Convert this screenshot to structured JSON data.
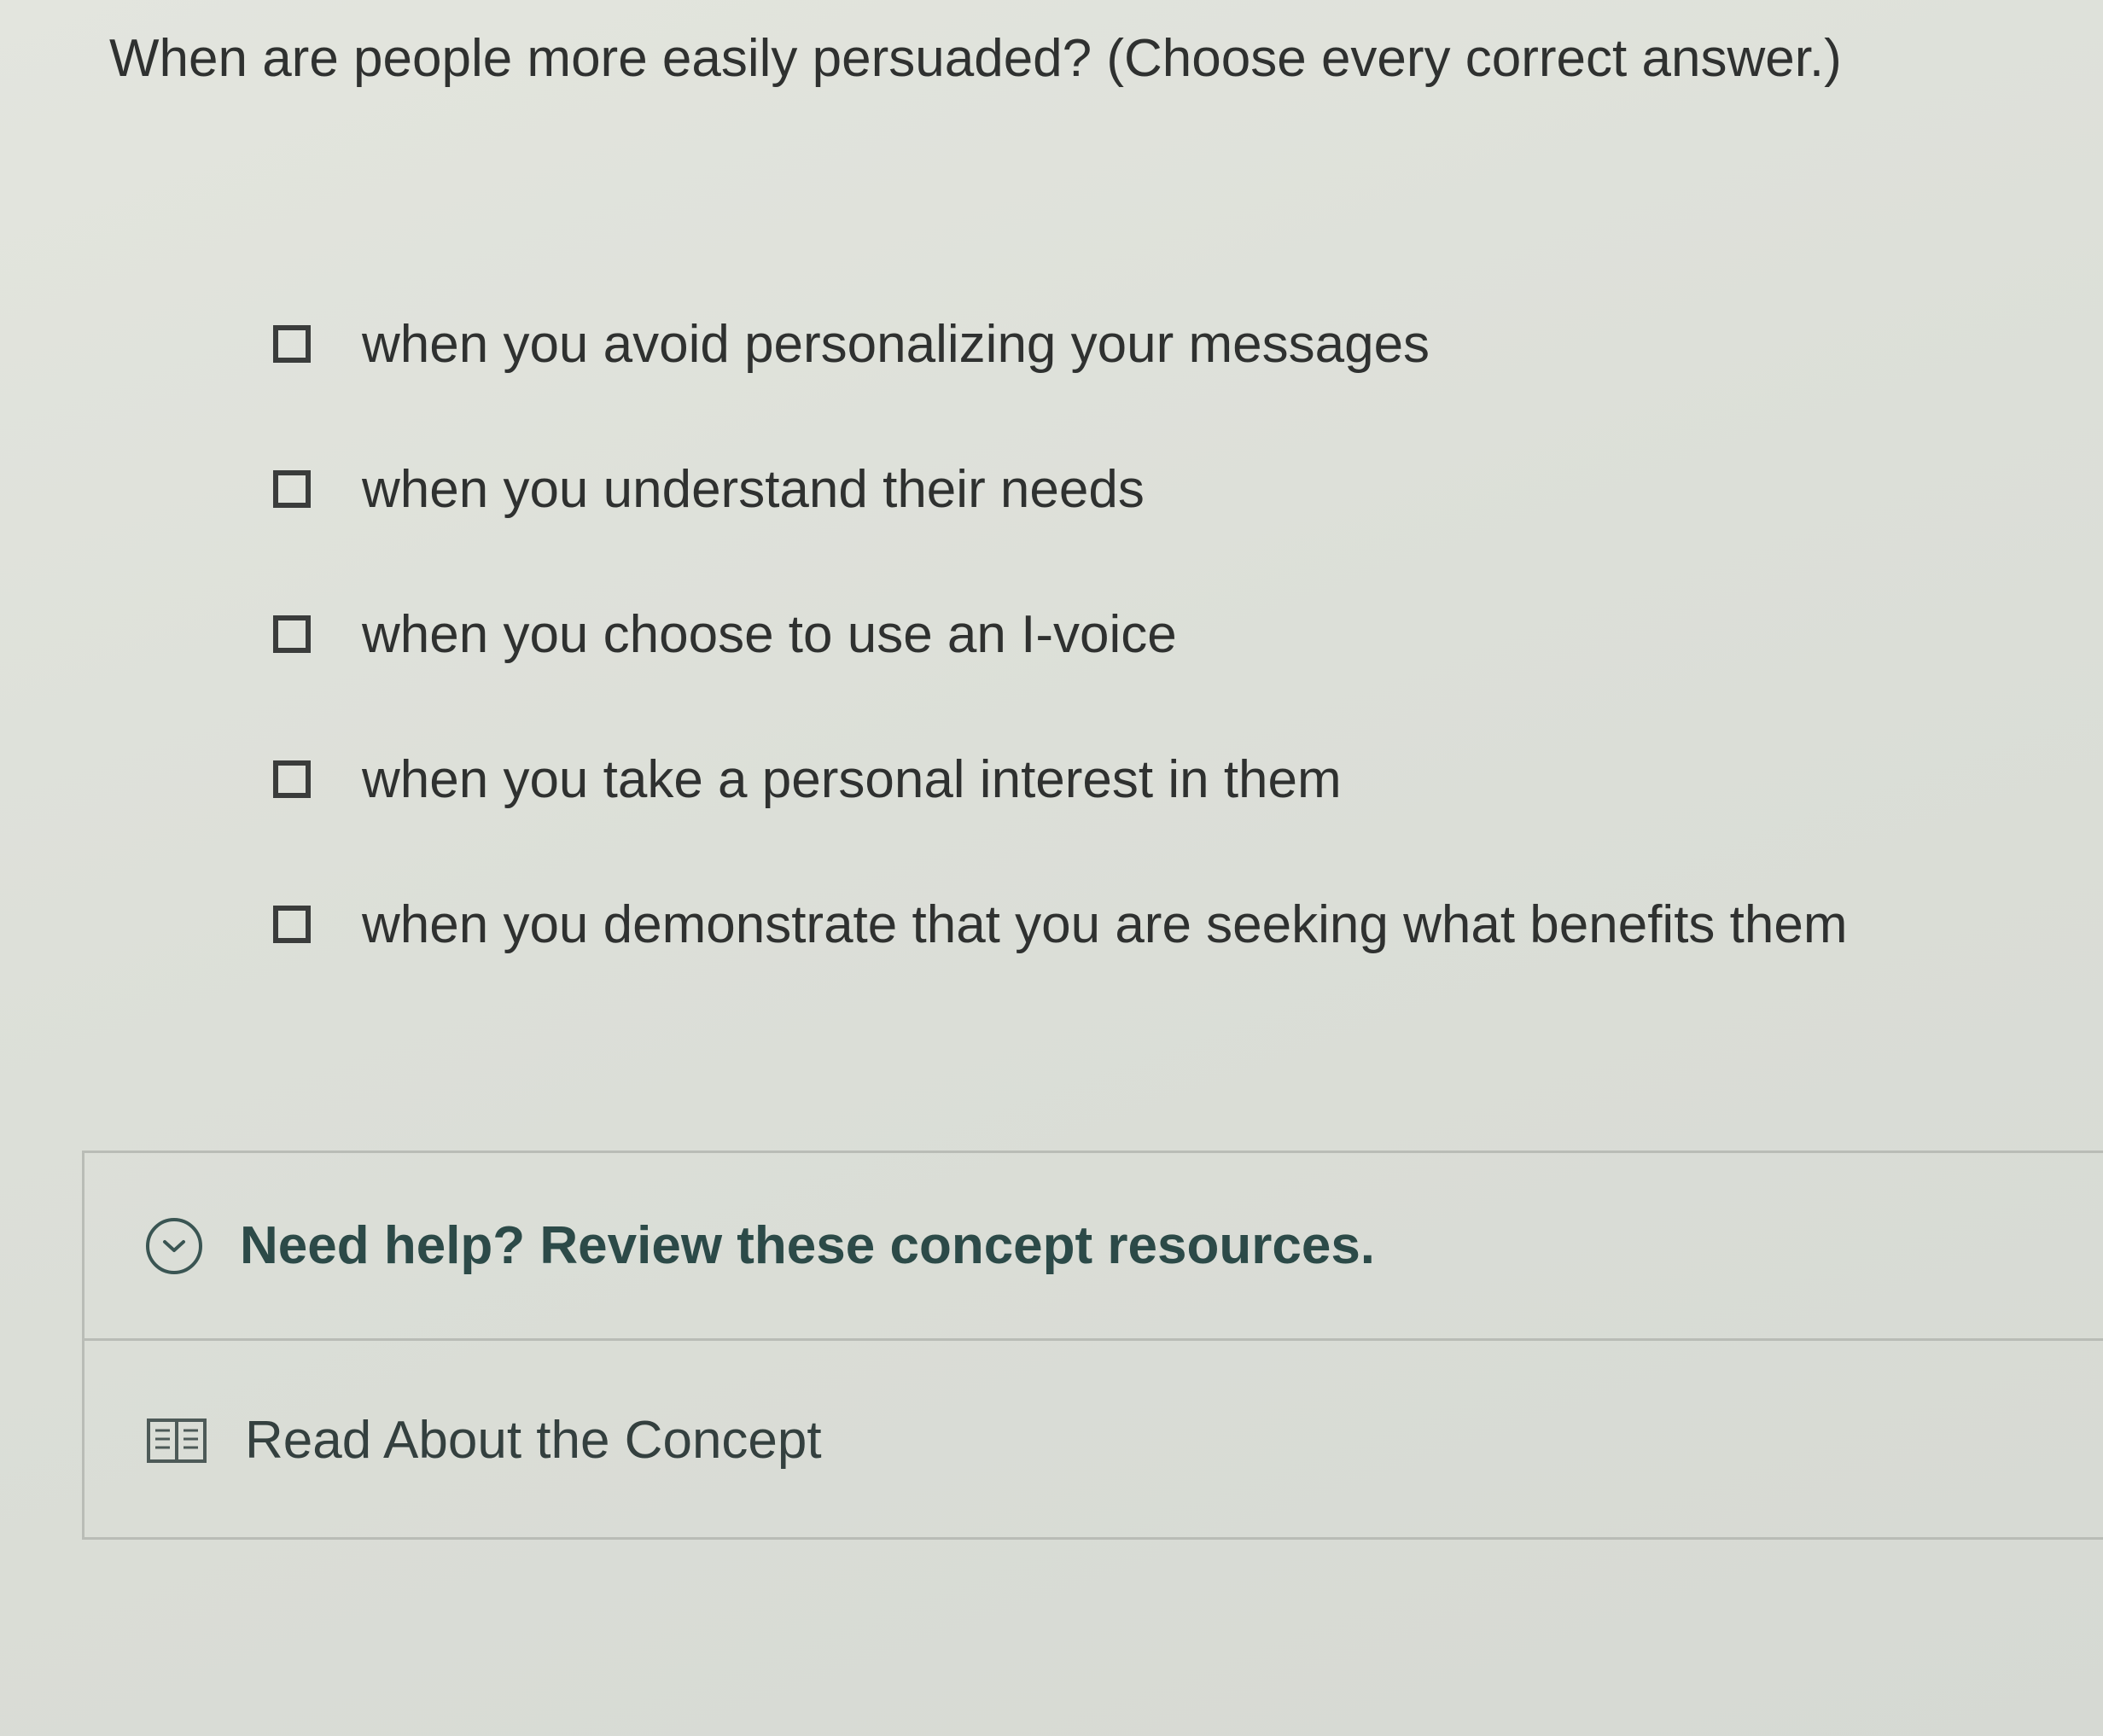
{
  "question": {
    "text": "When are people more easily persuaded? (Choose every correct answer.)"
  },
  "options": [
    {
      "label": "when you avoid personalizing your messages",
      "checked": false
    },
    {
      "label": "when you understand their needs",
      "checked": false
    },
    {
      "label": "when you choose to use an I-voice",
      "checked": false
    },
    {
      "label": "when you take a personal interest in them",
      "checked": false
    },
    {
      "label": "when you demonstrate that you are seeking what benefits them",
      "checked": false
    }
  ],
  "help": {
    "title": "Need help? Review these concept resources.",
    "icon": "chevron-down-icon",
    "resources": [
      {
        "label": "Read About the Concept",
        "icon": "book-icon"
      }
    ]
  },
  "colors": {
    "background": "#dde0d9",
    "text": "#2f3130",
    "accent": "#2c4a48",
    "border": "#b9bcb6"
  }
}
